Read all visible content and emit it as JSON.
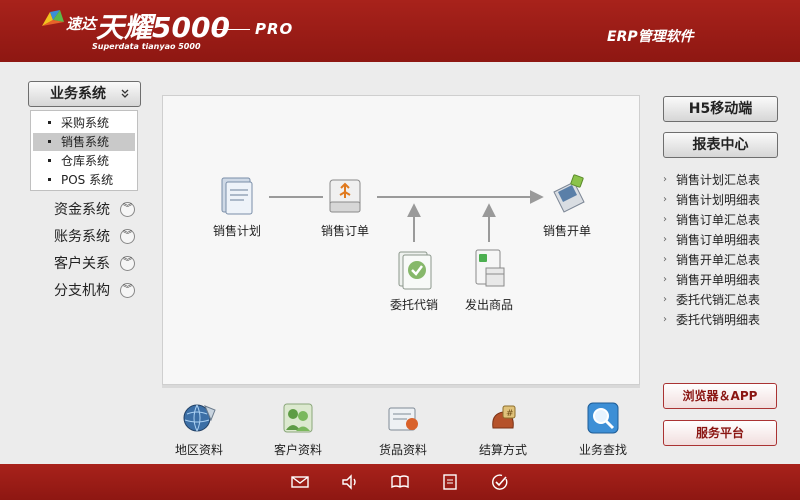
{
  "header": {
    "brand_cn": "速达",
    "brand_main": "天耀5000",
    "brand_pro": "PRO",
    "brand_sub": "Superdata tianyao 5000",
    "right_title": "ERP管理软件"
  },
  "nav": {
    "title": "业务系统",
    "sub_items": [
      {
        "label": "采购系统"
      },
      {
        "label": "销售系统"
      },
      {
        "label": "仓库系统"
      },
      {
        "label": "POS 系统"
      }
    ],
    "groups": [
      {
        "label": "资金系统"
      },
      {
        "label": "账务系统"
      },
      {
        "label": "客户关系"
      },
      {
        "label": "分支机构"
      }
    ]
  },
  "flow": {
    "plan": "销售计划",
    "order": "销售订单",
    "invoice": "销售开单",
    "consign": "委托代销",
    "ship": "发出商品"
  },
  "shortcuts": [
    {
      "label": "地区资料"
    },
    {
      "label": "客户资料"
    },
    {
      "label": "货品资料"
    },
    {
      "label": "结算方式"
    },
    {
      "label": "业务查找"
    }
  ],
  "right": {
    "h5_button": "H5移动端",
    "report_button": "报表中心",
    "reports": [
      {
        "label": "销售计划汇总表"
      },
      {
        "label": "销售计划明细表"
      },
      {
        "label": "销售订单汇总表"
      },
      {
        "label": "销售订单明细表"
      },
      {
        "label": "销售开单汇总表"
      },
      {
        "label": "销售开单明细表"
      },
      {
        "label": "委托代销汇总表"
      },
      {
        "label": "委托代销明细表"
      }
    ],
    "browser_button": "浏览器＆APP",
    "service_button": "服务平台"
  },
  "colors": {
    "brand_red": "#9b1c16",
    "panel_bg": "#f7f7f7",
    "page_bg": "#ececec"
  }
}
